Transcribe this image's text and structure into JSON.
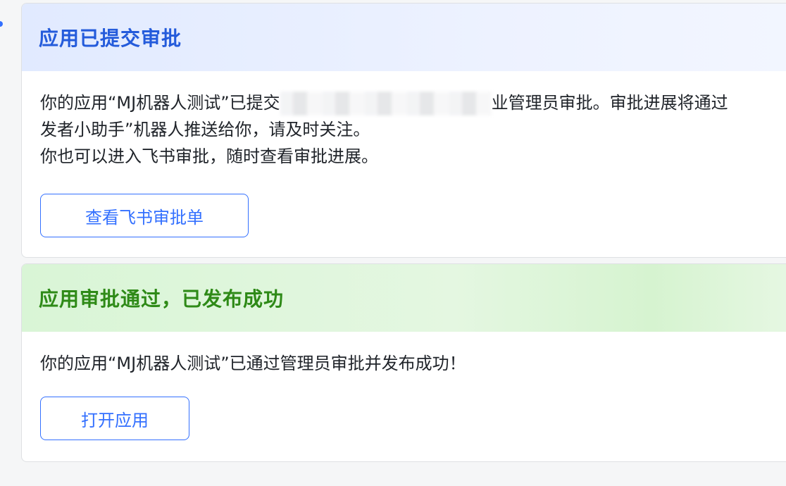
{
  "card_submitted": {
    "title": "应用已提交审批",
    "line1_start": "你的应用“MJ机器人测试”已提交",
    "line1_end": "业管理员审批。审批进展将通过",
    "line2": "发者小助手”机器人推送给你，请及时关注。",
    "line3": "你也可以进入飞书审批，随时查看审批进展。",
    "button_label": "查看飞书审批单"
  },
  "card_approved": {
    "title": "应用审批通过，已发布成功",
    "line1": "你的应用“MJ机器人测试”已通过管理员审批并发布成功！",
    "button_label": "打开应用"
  },
  "colors": {
    "accent_blue": "#3370ff",
    "title_blue": "#245bdb",
    "title_green": "#2e8a17"
  }
}
